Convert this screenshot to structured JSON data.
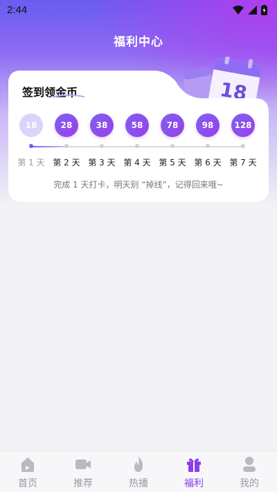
{
  "status_bar": {
    "time": "2:44"
  },
  "page_title": "福利中心",
  "checkin": {
    "title": "签到领金币",
    "calendar_date": "18",
    "coins": [
      "18",
      "28",
      "38",
      "58",
      "78",
      "98",
      "128"
    ],
    "days": [
      "第 1 天",
      "第 2 天",
      "第 3 天",
      "第 4 天",
      "第 5 天",
      "第 6 天",
      "第 7 天"
    ],
    "completed_days": 1,
    "hint": "完成 1 天打卡，明天别 “掉线”，记得回来哦~"
  },
  "tabbar": {
    "tabs": [
      {
        "label": "首页",
        "icon": "home-icon"
      },
      {
        "label": "推荐",
        "icon": "video-camera-icon"
      },
      {
        "label": "热播",
        "icon": "fire-icon"
      },
      {
        "label": "福利",
        "icon": "gift-icon"
      },
      {
        "label": "我的",
        "icon": "user-icon"
      }
    ],
    "active_index": 3
  },
  "colors": {
    "accent": "#8a3ee8",
    "coin_start": "#7e62f2",
    "coin_end": "#9a3ee8"
  }
}
